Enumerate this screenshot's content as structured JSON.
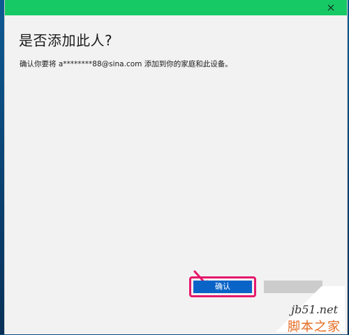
{
  "dialog": {
    "heading": "是否添加此人?",
    "message": "确认你要将 a********88@sina.com 添加到你的家庭和此设备。"
  },
  "buttons": {
    "confirm_label": "确认"
  },
  "watermark": {
    "url": "jb51.net",
    "name": "脚本之家"
  },
  "colors": {
    "titlebar": "#16c964",
    "confirm_button": "#0a64c8",
    "highlight": "#e6176c"
  },
  "icons": {
    "close": "close-icon",
    "annotation": "arrow-icon"
  }
}
